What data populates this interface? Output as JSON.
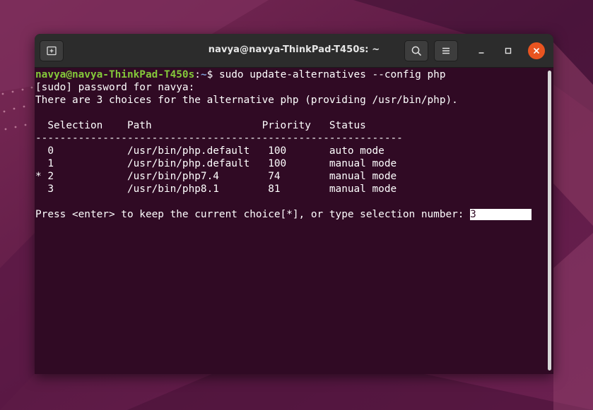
{
  "window": {
    "title": "navya@navya-ThinkPad-T450s: ~"
  },
  "terminal": {
    "prompt_user": "navya@navya-ThinkPad-T450s",
    "prompt_sep": ":",
    "prompt_path": "~",
    "prompt_symbol": "$ ",
    "command": "sudo update-alternatives --config php",
    "lines": [
      "[sudo] password for navya:",
      "There are 3 choices for the alternative php (providing /usr/bin/php).",
      "",
      "  Selection    Path                  Priority   Status",
      "------------------------------------------------------------",
      "  0            /usr/bin/php.default   100       auto mode",
      "  1            /usr/bin/php.default   100       manual mode",
      "* 2            /usr/bin/php7.4        74        manual mode",
      "  3            /usr/bin/php8.1        81        manual mode",
      ""
    ],
    "question": "Press <enter> to keep the current choice[*], or type selection number: ",
    "input_value": "3"
  },
  "icons": {
    "new_tab": "new-tab-icon",
    "search": "search-icon",
    "menu": "hamburger-menu-icon",
    "minimize": "minimize-icon",
    "maximize": "maximize-icon",
    "close": "close-icon"
  },
  "colors": {
    "terminal_bg": "#300a24",
    "titlebar_bg": "#2c2c2c",
    "prompt_user": "#84c93a",
    "prompt_path": "#7f9fd6",
    "close_button": "#e95420"
  }
}
